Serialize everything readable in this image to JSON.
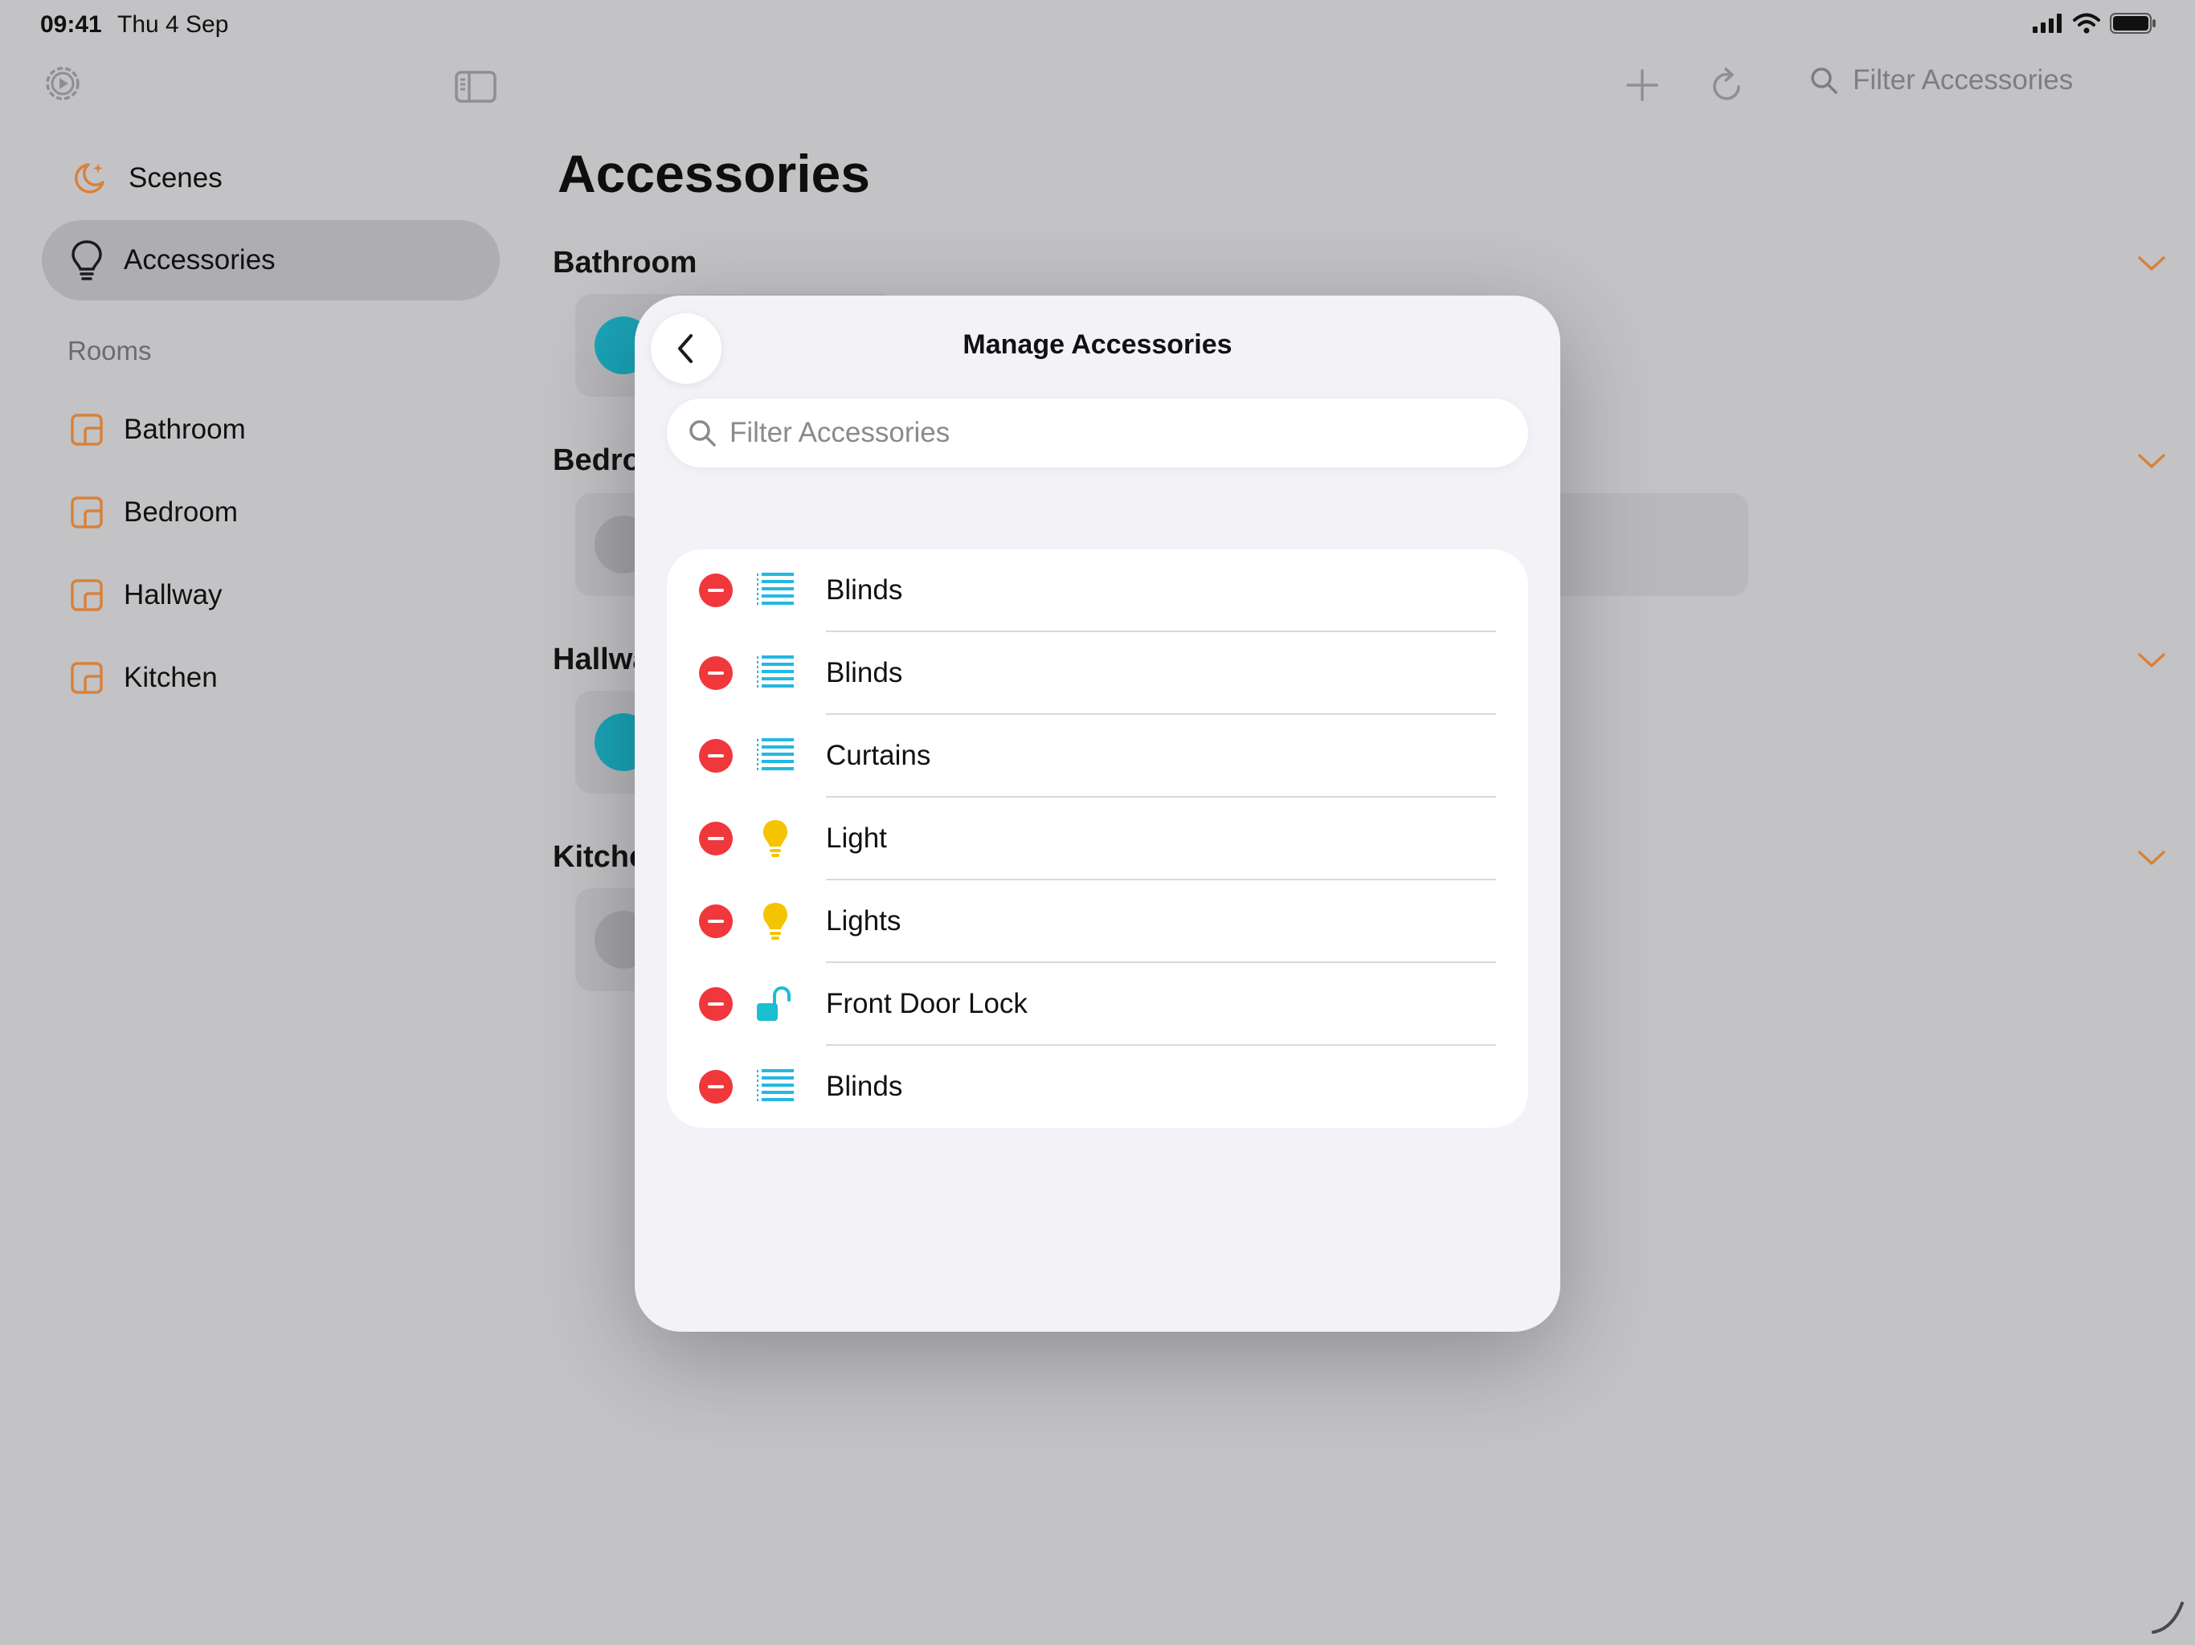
{
  "status_bar": {
    "time": "09:41",
    "date": "Thu 4 Sep",
    "battery_level": 0.9
  },
  "toolbar": {
    "search_placeholder": "Filter Accessories"
  },
  "sidebar": {
    "items": [
      {
        "label": "Scenes",
        "icon": "moon-sparkle-icon",
        "selected": false
      },
      {
        "label": "Accessories",
        "icon": "lightbulb-icon",
        "selected": true
      }
    ],
    "rooms_heading": "Rooms",
    "rooms": [
      {
        "label": "Bathroom",
        "icon": "room-icon"
      },
      {
        "label": "Bedroom",
        "icon": "room-icon"
      },
      {
        "label": "Hallway",
        "icon": "room-icon"
      },
      {
        "label": "Kitchen",
        "icon": "room-icon"
      }
    ]
  },
  "main": {
    "title": "Accessories",
    "sections": [
      {
        "title": "Bathroom"
      },
      {
        "title": "Bedro"
      },
      {
        "title": "Hallwa"
      },
      {
        "title": "Kitche"
      }
    ]
  },
  "modal": {
    "title": "Manage Accessories",
    "search_placeholder": "Filter Accessories",
    "accessories": [
      {
        "name": "Blinds",
        "icon": "blinds-icon"
      },
      {
        "name": "Blinds",
        "icon": "blinds-icon"
      },
      {
        "name": "Curtains",
        "icon": "blinds-icon"
      },
      {
        "name": "Light",
        "icon": "lightbulb-icon"
      },
      {
        "name": "Lights",
        "icon": "lightbulb-icon"
      },
      {
        "name": "Front Door Lock",
        "icon": "lock-open-icon"
      },
      {
        "name": "Blinds",
        "icon": "blinds-icon"
      }
    ]
  },
  "colors": {
    "accent": "#d9813a",
    "dimmed_background": "#c3c3c6",
    "remove_red": "#f0373c",
    "blinds_cyan": "#25b8df",
    "light_yellow": "#f5c400",
    "lock_teal": "#1bbfcf"
  }
}
